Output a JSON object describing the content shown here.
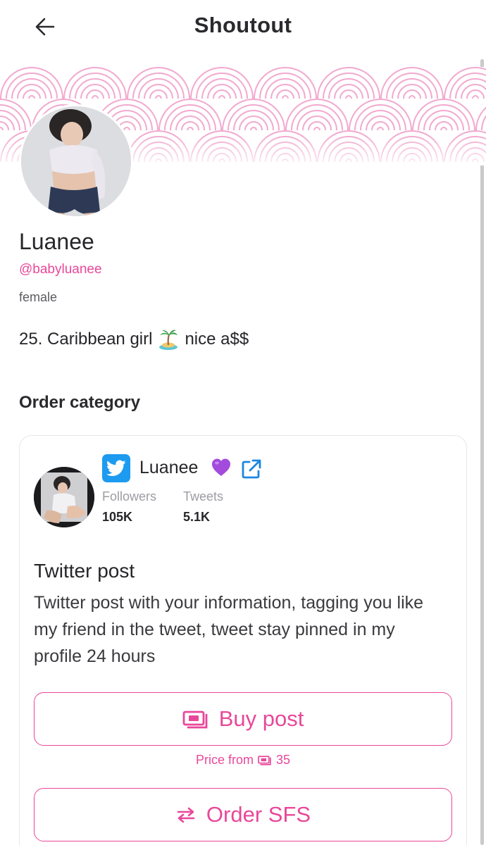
{
  "header": {
    "title": "Shoutout",
    "back_icon": "arrow-left-icon"
  },
  "profile": {
    "display_name": "Luanee",
    "handle": "@babyluanee",
    "gender": "female",
    "bio_before_emoji": "25. Caribbean girl",
    "bio_emoji": "desert-island-emoji",
    "bio_after_emoji": "nice a$$"
  },
  "section": {
    "order_category_title": "Order category"
  },
  "twitter_card": {
    "platform_icon": "twitter-bird-icon",
    "name": "Luanee",
    "heart_icon": "purple-heart-emoji",
    "external_link_icon": "external-link-icon",
    "followers_label": "Followers",
    "followers_value": "105K",
    "tweets_label": "Tweets",
    "tweets_value": "5.1K",
    "post_title": "Twitter post",
    "post_description": "Twitter post with your information, tagging you like my friend in the tweet, tweet stay pinned in my profile 24 hours",
    "buy_button_label": "Buy post",
    "price_prefix": "Price from",
    "price_value": "35",
    "order_sfs_label": "Order SFS"
  },
  "colors": {
    "accent": "#e8489a",
    "twitter_blue": "#1d9bf0",
    "text_primary": "#26262a",
    "text_muted": "#9d9da3",
    "banner_pattern": "#f2a9cf"
  }
}
